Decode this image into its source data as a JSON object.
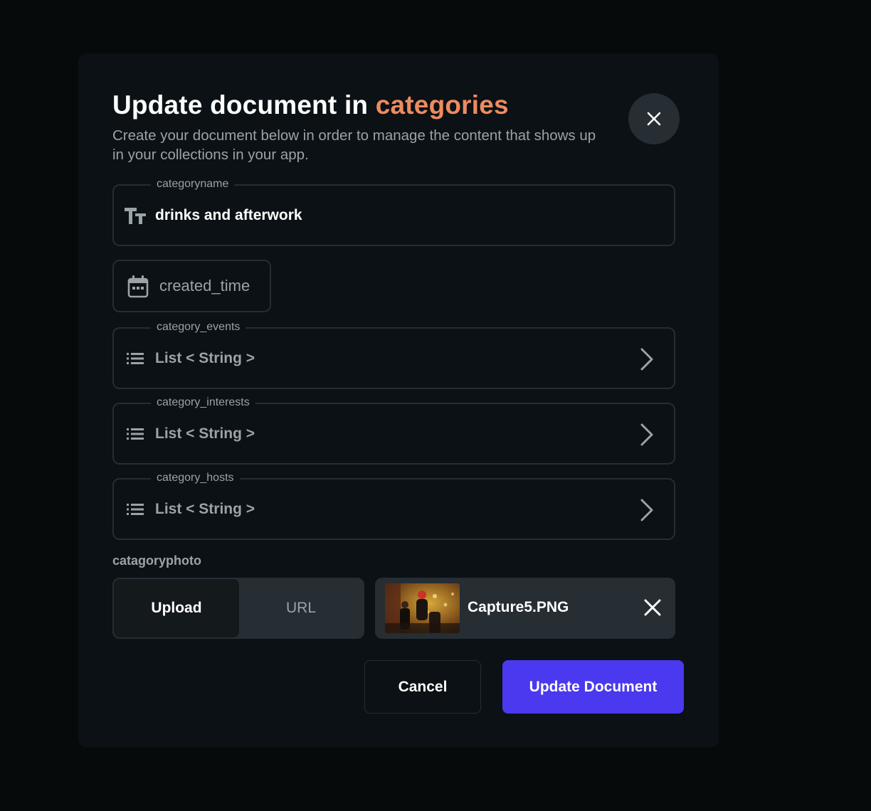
{
  "header": {
    "title_prefix": "Update document in",
    "title_collection": "categories",
    "subtitle": "Create your document below in order to manage the content that shows up in your collections in your app.",
    "close_icon": "close-icon"
  },
  "fields": {
    "categoryname": {
      "label": "categoryname",
      "value": "drinks and afterwork",
      "icon": "text-type-icon"
    },
    "created_time": {
      "value": "created_time",
      "icon": "calendar-icon"
    },
    "category_events": {
      "label": "category_events",
      "value": "List < String >",
      "icon": "list-icon"
    },
    "category_interests": {
      "label": "category_interests",
      "value": "List < String >",
      "icon": "list-icon"
    },
    "category_hosts": {
      "label": "category_hosts",
      "value": "List < String >",
      "icon": "list-icon"
    }
  },
  "photo": {
    "label": "catagoryphoto",
    "tabs": [
      {
        "label": "Upload",
        "selected": true
      },
      {
        "label": "URL",
        "selected": false
      }
    ],
    "file_name": "Capture5.PNG"
  },
  "actions": {
    "cancel_label": "Cancel",
    "submit_label": "Update Document"
  },
  "colors": {
    "accent": "#ee8b60",
    "primary": "#4b39ef",
    "surface": "#0b1114",
    "border": "#262d33",
    "muted_text": "#9aa3a8"
  }
}
